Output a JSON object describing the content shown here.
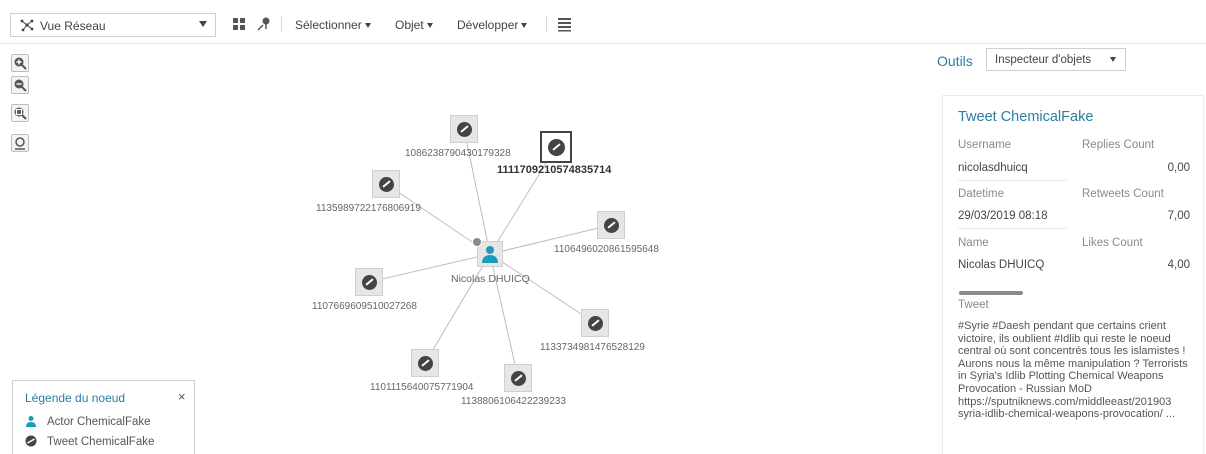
{
  "toolbar": {
    "view_select": "Vue Réseau",
    "menus": [
      "Sélectionner",
      "Objet",
      "Développer"
    ]
  },
  "graph": {
    "center": {
      "label": "Nicolas DHUICQ"
    },
    "tweets": [
      {
        "id": "1086238790430179328"
      },
      {
        "id": "1111709210574835714",
        "selected": true
      },
      {
        "id": "1135989722176806919"
      },
      {
        "id": "1106496020861595648"
      },
      {
        "id": "1107669609510027268"
      },
      {
        "id": "1133734981476528129"
      },
      {
        "id": "1101115640075771904"
      },
      {
        "id": "1138806106422239233"
      }
    ]
  },
  "legend": {
    "title": "Légende du noeud",
    "close": "×",
    "items": [
      "Actor ChemicalFake",
      "Tweet ChemicalFake"
    ]
  },
  "panel": {
    "tools_label": "Outils",
    "tools_select": "Inspecteur d'objets",
    "card_title": "Tweet ChemicalFake",
    "fields": {
      "username_label": "Username",
      "username_value": "nicolasdhuicq",
      "replies_label": "Replies Count",
      "replies_value": "0,00",
      "datetime_label": "Datetime",
      "datetime_value": "29/03/2019 08:18",
      "retweets_label": "Retweets Count",
      "retweets_value": "7,00",
      "name_label": "Name",
      "name_value": "Nicolas DHUICQ",
      "likes_label": "Likes Count",
      "likes_value": "4,00",
      "tweet_label": "Tweet"
    },
    "tweet_text": "#Syrie #Daesh pendant que certains crient victoire, ils oublient #Idlib qui reste le noeud central où sont concentrés tous les islamistes ! Aurons nous la même manipulation ? Terrorists in Syria's Idlib Plotting Chemical Weapons Provocation - Russian MoD https://sputniknews.com/middleeast/201903 syria-idlib-chemical-weapons-provocation/ ..."
  },
  "colors": {
    "accent": "#2b7ea1",
    "actor": "#1b9bb5",
    "node_bg": "#e6e6e6"
  }
}
